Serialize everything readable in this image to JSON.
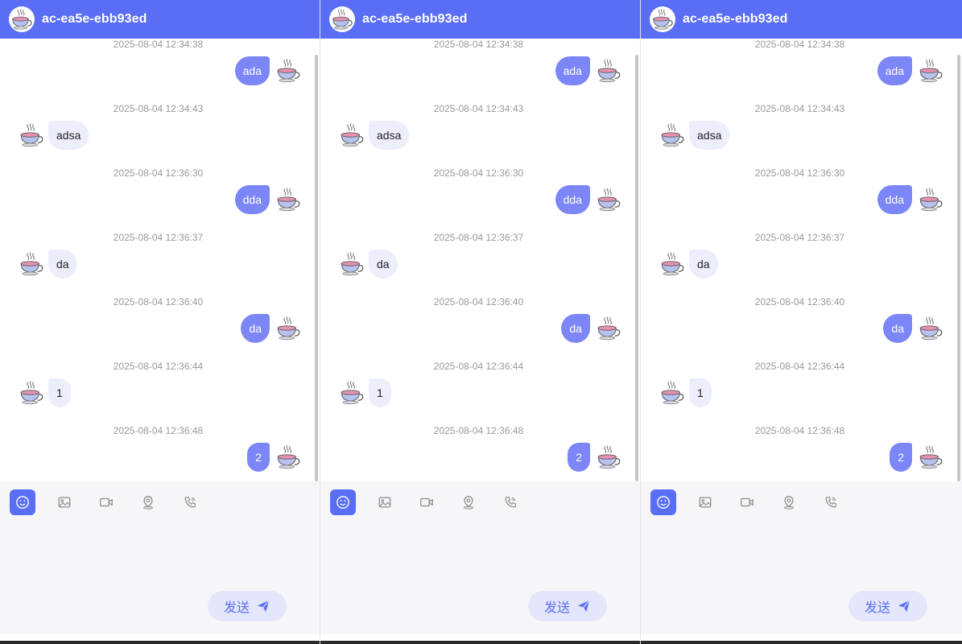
{
  "panels": [
    {
      "title": "ac-ea5e-ebb93ed"
    },
    {
      "title": "ac-ea5e-ebb93ed"
    },
    {
      "title": "ac-ea5e-ebb93ed"
    }
  ],
  "messages": [
    {
      "time": "2025-08-04 12:34:38",
      "text": "ada",
      "side": "right"
    },
    {
      "time": "2025-08-04 12:34:43",
      "text": "adsa",
      "side": "left"
    },
    {
      "time": "2025-08-04 12:36:30",
      "text": "dda",
      "side": "right"
    },
    {
      "time": "2025-08-04 12:36:37",
      "text": "da",
      "side": "left"
    },
    {
      "time": "2025-08-04 12:36:40",
      "text": "da",
      "side": "right"
    },
    {
      "time": "2025-08-04 12:36:44",
      "text": "1",
      "side": "left"
    },
    {
      "time": "2025-08-04 12:36:48",
      "text": "2",
      "side": "right"
    }
  ],
  "toolbar": {
    "tools": [
      {
        "icon": "emoji-icon",
        "active": true
      },
      {
        "icon": "image-icon",
        "active": false
      },
      {
        "icon": "video-icon",
        "active": false
      },
      {
        "icon": "location-icon",
        "active": false
      },
      {
        "icon": "phone-icon",
        "active": false
      }
    ]
  },
  "send": {
    "label": "发送",
    "icon": "send-icon"
  },
  "colors": {
    "accent": "#5a6ef5",
    "bubble_sent": "#7c86f7",
    "bubble_received": "#eceefb",
    "timestamp": "#999999"
  }
}
